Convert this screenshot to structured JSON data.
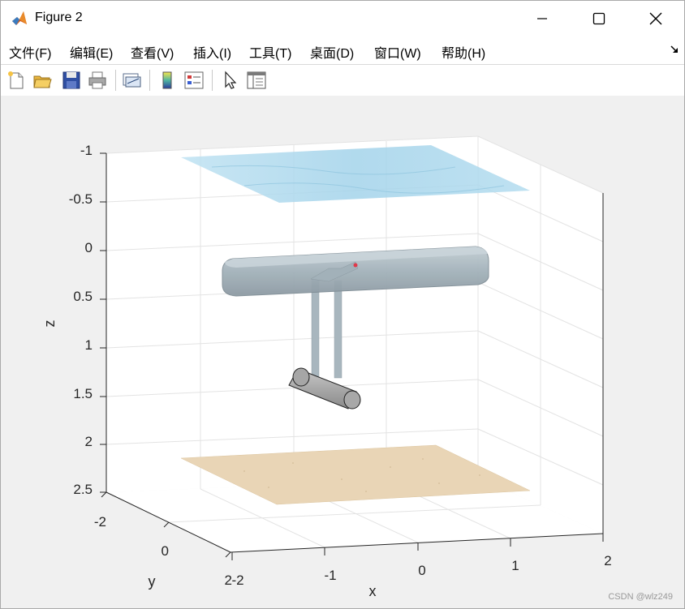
{
  "window": {
    "title": "Figure 2"
  },
  "menu": {
    "items": [
      "文件(F)",
      "编辑(E)",
      "查看(V)",
      "插入(I)",
      "工具(T)",
      "桌面(D)",
      "窗口(W)",
      "帮助(H)"
    ]
  },
  "toolbar": {
    "buttons": [
      "new-figure-icon",
      "open-file-icon",
      "save-icon",
      "print-icon",
      "link-plot-icon",
      "colorbar-icon",
      "legend-icon",
      "edit-plot-arrow-icon",
      "property-inspector-icon"
    ]
  },
  "plot": {
    "xlabel": "x",
    "ylabel": "y",
    "zlabel": "z",
    "z_ticks": [
      "-1",
      "-0.5",
      "0",
      "0.5",
      "1",
      "1.5",
      "2",
      "2.5"
    ],
    "x_ticks": [
      "-2",
      "-1",
      "0",
      "1",
      "2"
    ],
    "y_ticks": [
      "-2",
      "0",
      "2"
    ],
    "colors": {
      "water": "#a9d6ea",
      "seabed": "#e8d3b5",
      "hull": "#a7b5bd",
      "cylinder": "#a3a3a3"
    }
  },
  "watermark": "CSDN @wlz249"
}
